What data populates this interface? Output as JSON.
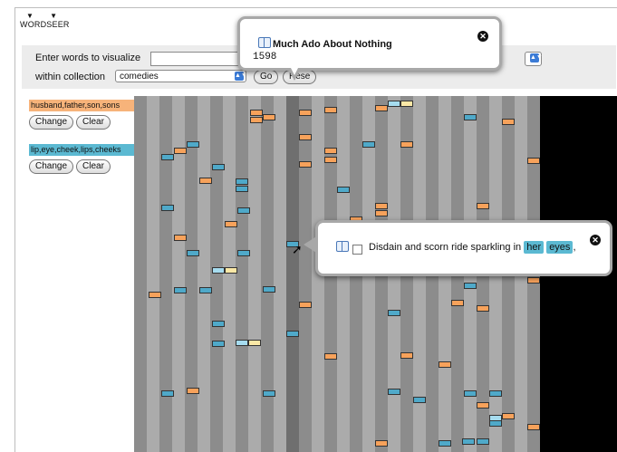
{
  "app": {
    "logo": "WORDSEER",
    "logo_mark": "▼ ▼"
  },
  "search": {
    "label": "Enter words to visualize",
    "value": ""
  },
  "collection": {
    "label": "within collection",
    "selected": "comedies"
  },
  "buttons": {
    "go": "Go",
    "reset": "Rese"
  },
  "word_sets": [
    {
      "words": "husband,father,son,sons",
      "color": "#f7b37a",
      "change": "Change",
      "clear": "Clear"
    },
    {
      "words": "lip,eye,cheek,lips,cheeks",
      "color": "#5bb9d2",
      "change": "Change",
      "clear": "Clear"
    }
  ],
  "tooltip_play": {
    "title": "Much Ado About Nothing",
    "year": "1598"
  },
  "tooltip_sentence": {
    "before": "Disdain and scorn ride sparkling in",
    "word1": "her",
    "word2": "eyes",
    "after": ","
  },
  "icons": {
    "close": "close-icon",
    "book": "book-icon",
    "checkbox": "checkbox-icon",
    "cursor": "pointer-cursor-icon"
  },
  "colors": {
    "orange": "#f7a25b",
    "blue": "#4fa9c9",
    "stripe_dark": "#8c8c8c",
    "stripe_light": "#ababab",
    "highlight": "#5bb9d2"
  }
}
